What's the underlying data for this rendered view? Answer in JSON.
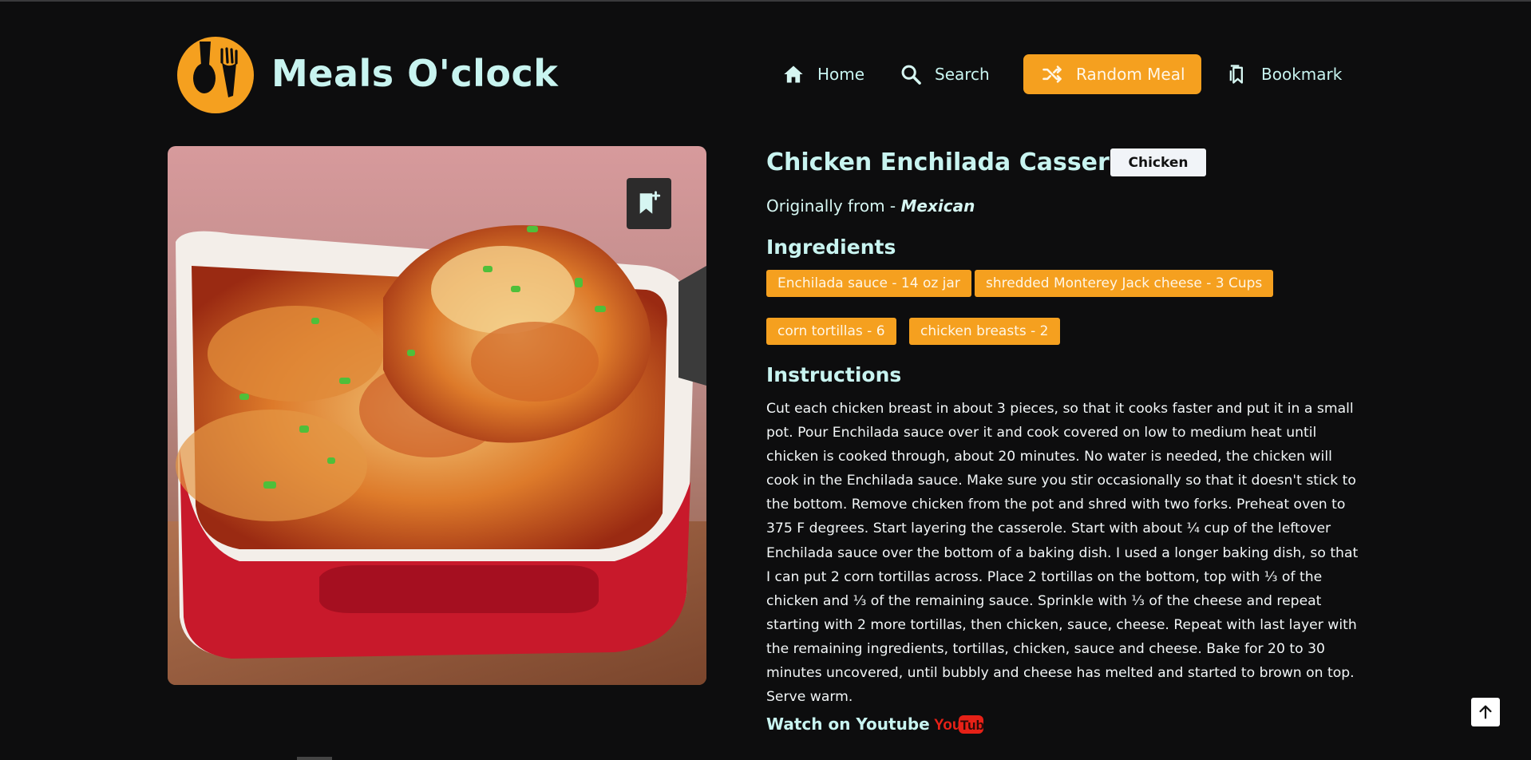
{
  "header": {
    "brand": "Meals O'clock",
    "nav": [
      {
        "label": "Home",
        "icon": "home-icon"
      },
      {
        "label": "Search",
        "icon": "search-icon"
      },
      {
        "label": "Random Meal",
        "icon": "shuffle-icon"
      },
      {
        "label": "Bookmark",
        "icon": "bookmark-icon"
      }
    ]
  },
  "meal": {
    "title": "Chicken Enchilada Casserole",
    "category": "Chicken",
    "origin_prefix": "Originally from - ",
    "origin": "Mexican",
    "ingredients_heading": "Ingredients",
    "ingredients": [
      "Enchilada sauce - 14 oz jar",
      "shredded Monterey Jack cheese - 3 Cups",
      "corn tortillas - 6",
      "chicken breasts - 2"
    ],
    "instructions_heading": "Instructions",
    "instructions": "Cut each chicken breast in about 3 pieces, so that it cooks faster and put it in a small pot. Pour Enchilada sauce over it and cook covered on low to medium heat until chicken is cooked through, about 20 minutes. No water is needed, the chicken will cook in the Enchilada sauce. Make sure you stir occasionally so that it doesn't stick to the bottom. Remove chicken from the pot and shred with two forks. Preheat oven to 375 F degrees. Start layering the casserole. Start with about ¼ cup of the leftover Enchilada sauce over the bottom of a baking dish. I used a longer baking dish, so that I can put 2 corn tortillas across. Place 2 tortillas on the bottom, top with ⅓ of the chicken and ⅓ of the remaining sauce. Sprinkle with ⅓ of the cheese and repeat starting with 2 more tortillas, then chicken, sauce, cheese. Repeat with last layer with the remaining ingredients, tortillas, chicken, sauce and cheese. Bake for 20 to 30 minutes uncovered, until bubbly and cheese has melted and started to brown on top. Serve warm.",
    "watch_label": "Watch on Youtube",
    "youtube_logo": {
      "you": "You",
      "tube": "Tube"
    }
  },
  "colors": {
    "background": "#0d0d0e",
    "accent": "#f5a01f",
    "heading": "#c8f4f0",
    "youtube_red": "#e62117"
  }
}
